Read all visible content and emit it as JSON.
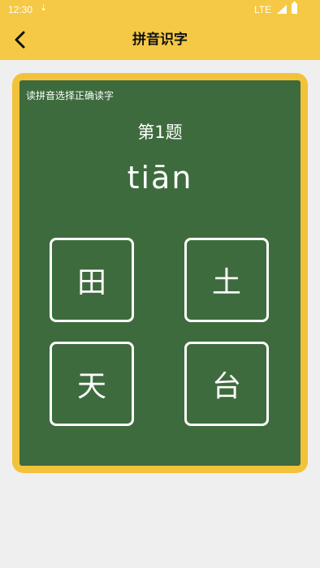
{
  "status_bar": {
    "time": "12:30",
    "network": "LTE",
    "notification_icon": "download-icon",
    "signal_icon": "signal-icon",
    "battery_icon": "battery-icon"
  },
  "app_bar": {
    "title": "拼音识字",
    "back_icon": "chevron-left-icon",
    "background": "#f5c945"
  },
  "quiz": {
    "instruction": "读拼音选择正确读字",
    "question_number": "第1题",
    "pinyin": "tiān",
    "options": [
      "田",
      "土",
      "天",
      "台"
    ],
    "board_color": "#3d6b3d",
    "frame_color": "#f3c23b"
  }
}
